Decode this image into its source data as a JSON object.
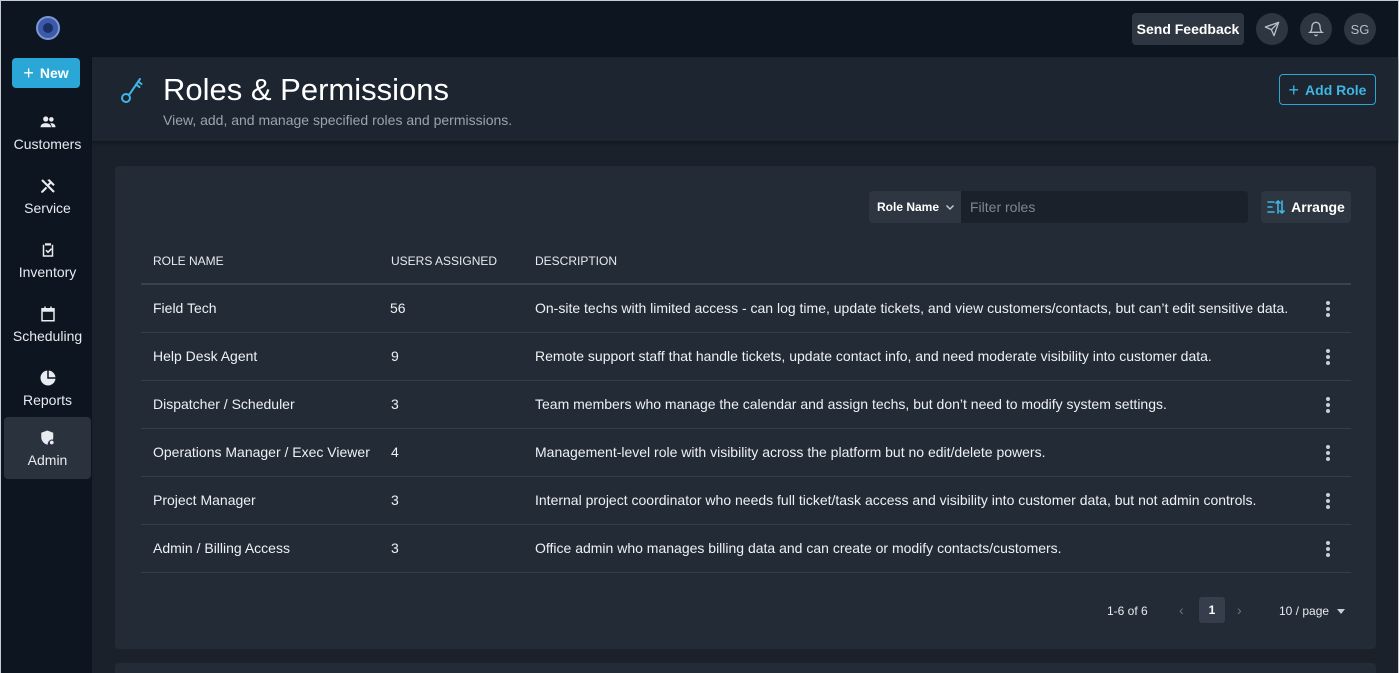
{
  "topbar": {
    "logo_icon": "app-logo",
    "send_feedback_label": "Send Feedback",
    "send_icon": "paper-plane-icon",
    "notifications_icon": "bell-icon",
    "avatar_initials": "SG"
  },
  "sidebar": {
    "new_label": "New",
    "items": [
      {
        "label": "Customers",
        "icon": "users-icon"
      },
      {
        "label": "Service",
        "icon": "tools-icon"
      },
      {
        "label": "Inventory",
        "icon": "clipboard-check-icon"
      },
      {
        "label": "Scheduling",
        "icon": "calendar-icon"
      },
      {
        "label": "Reports",
        "icon": "pie-chart-icon"
      },
      {
        "label": "Admin",
        "icon": "shield-gear-icon",
        "active": true
      }
    ]
  },
  "header": {
    "title": "Roles & Permissions",
    "subtitle": "View, add, and manage specified roles and permissions.",
    "add_role_label": "Add Role",
    "icon": "key-icon"
  },
  "filter": {
    "field_label": "Role Name",
    "placeholder": "Filter roles",
    "value": "",
    "arrange_label": "Arrange"
  },
  "table": {
    "columns": [
      "ROLE NAME",
      "USERS ASSIGNED",
      "DESCRIPTION"
    ],
    "rows": [
      {
        "name": "Field Tech",
        "users": "56",
        "description": "On-site techs with limited access - can log time, update tickets, and view customers/contacts, but can’t edit sensitive data."
      },
      {
        "name": "Help Desk Agent",
        "users": "9",
        "description": "Remote support staff that handle tickets, update contact info, and need moderate visibility into customer data."
      },
      {
        "name": "Dispatcher / Scheduler",
        "users": "3",
        "description": "Team members who manage the calendar and assign techs, but don’t need to modify system settings."
      },
      {
        "name": "Operations Manager / Exec Viewer",
        "users": "4",
        "description": "Management-level role with visibility across the platform but no edit/delete powers."
      },
      {
        "name": "Project Manager",
        "users": "3",
        "description": "Internal project coordinator who needs full ticket/task access and visibility into customer data, but not admin controls."
      },
      {
        "name": "Admin / Billing Access",
        "users": "3",
        "description": "Office admin who manages billing data and can create or modify contacts/customers."
      }
    ]
  },
  "pagination": {
    "range_text": "1-6 of 6",
    "current_page": "1",
    "page_size": "10 / page"
  },
  "colors": {
    "accent": "#2aa7d6",
    "background": "#0d1520",
    "panel": "#232b36"
  }
}
